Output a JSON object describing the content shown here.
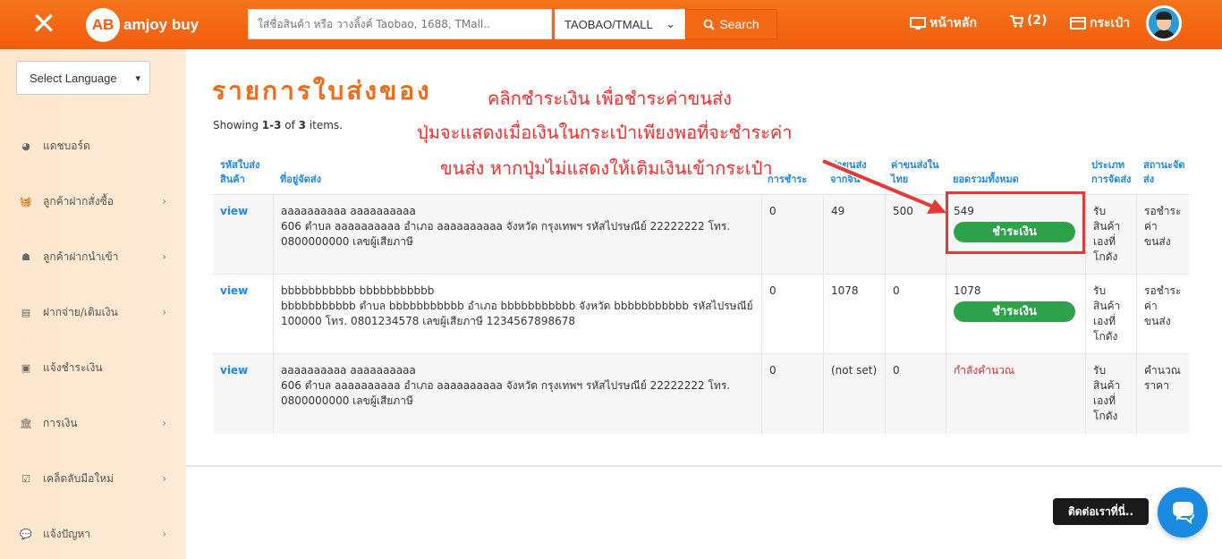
{
  "header": {
    "logo_letters": "AB",
    "logo_text": "amjoy buy",
    "search_placeholder": "ใส่ชื่อสินค้า หรือ วางลิ้งค์ Taobao, 1688, TMall..",
    "search_source": "TAOBAO/TMALL",
    "search_button": "Search",
    "nav_home": "หน้าหลัก",
    "nav_cart": "(2)",
    "nav_wallet": "กระเป๋า"
  },
  "sidebar": {
    "language": "Select Language",
    "items": [
      {
        "label": "แดชบอร์ด",
        "icon": "pie-chart-icon",
        "has_submenu": false
      },
      {
        "label": "ลูกค้าฝากสั่งซื้อ",
        "icon": "basket-icon",
        "has_submenu": true
      },
      {
        "label": "ลูกค้าฝากนำเข้า",
        "icon": "user-icon",
        "has_submenu": true
      },
      {
        "label": "ฝากจ่าย/เติมเงิน",
        "icon": "credit-card-icon",
        "has_submenu": true
      },
      {
        "label": "แจ้งชำระเงิน",
        "icon": "money-icon",
        "has_submenu": false
      },
      {
        "label": "การเงิน",
        "icon": "bank-icon",
        "has_submenu": true
      },
      {
        "label": "เคล็ดลับมือใหม่",
        "icon": "checkbox-icon",
        "has_submenu": true
      },
      {
        "label": "แจ้งปัญหา",
        "icon": "comment-icon",
        "has_submenu": true
      }
    ]
  },
  "main": {
    "title": "รายการใบส่งของ",
    "summary_prefix": "Showing ",
    "summary_range": "1-3",
    "summary_mid": " of ",
    "summary_total": "3",
    "summary_suffix": " items.",
    "columns": {
      "id": "รหัสใบส่งสินค้า",
      "address": "ที่อยู่จัดส่ง",
      "payment": "การชำระ",
      "china_ship": "ค่าขนส่งจากจีน",
      "thai_ship": "ค่าขนส่งในไทย",
      "total": "ยอดรวมทั้งหมด",
      "delivery_type": "ประเภทการจัดส่ง",
      "status": "สถานะจัดส่ง"
    },
    "rows": [
      {
        "action": "view",
        "name": "aaaaaaaaaa aaaaaaaaaa",
        "address": "606 ตำบล aaaaaaaaaa อำเภอ aaaaaaaaaa จังหวัด กรุงเทพฯ รหัสไปรษณีย์ 22222222 โทร. 0800000000 เลขผู้เสียภาษี",
        "payment": "0",
        "china_ship": "49",
        "thai_ship": "500",
        "total": "549",
        "pay_button": "ชำระเงิน",
        "delivery_type": "รับสินค้าเองที่โกดัง",
        "status": "รอชำระค่าขนส่ง"
      },
      {
        "action": "view",
        "name": "bbbbbbbbbbb bbbbbbbbbbb",
        "address": "bbbbbbbbbbb ตำบล bbbbbbbbbbb อำเภอ bbbbbbbbbbb จังหวัด bbbbbbbbbbb รหัสไปรษณีย์ 100000 โทร. 0801234578 เลขผู้เสียภาษี 1234567898678",
        "payment": "0",
        "china_ship": "1078",
        "thai_ship": "0",
        "total": "1078",
        "pay_button": "ชำระเงิน",
        "delivery_type": "รับสินค้าเองที่โกดัง",
        "status": "รอชำระค่าขนส่ง"
      },
      {
        "action": "view",
        "name": "aaaaaaaaaa aaaaaaaaaa",
        "address": "606 ตำบล aaaaaaaaaa อำเภอ aaaaaaaaaa จังหวัด กรุงเทพฯ รหัสไปรษณีย์ 22222222 โทร. 0800000000 เลขผู้เสียภาษี",
        "payment": "0",
        "china_ship": "(not set)",
        "thai_ship": "0",
        "total": "กำลังคำนวณ",
        "pay_button": "",
        "delivery_type": "รับสินค้าเองที่โกดัง",
        "status": "คำนวณราคา"
      }
    ]
  },
  "annotation": {
    "line1": "คลิกชำระเงิน เพื่อชำระค่าขนส่ง",
    "line2": "ปุ่มจะแสดงเมื่อเงินในกระเป๋าเพียงพอที่จะชำระค่า",
    "line3": "ขนส่ง หากปุ่มไม่แสดงให้เติมเงินเข้ากระเป๋า"
  },
  "contact": {
    "label": "ติดต่อเราที่นี่.."
  },
  "colors": {
    "brand": "#f25d0e",
    "link": "#1e88e5",
    "pay": "#2ea24a",
    "annotation": "#ff2a2a"
  }
}
